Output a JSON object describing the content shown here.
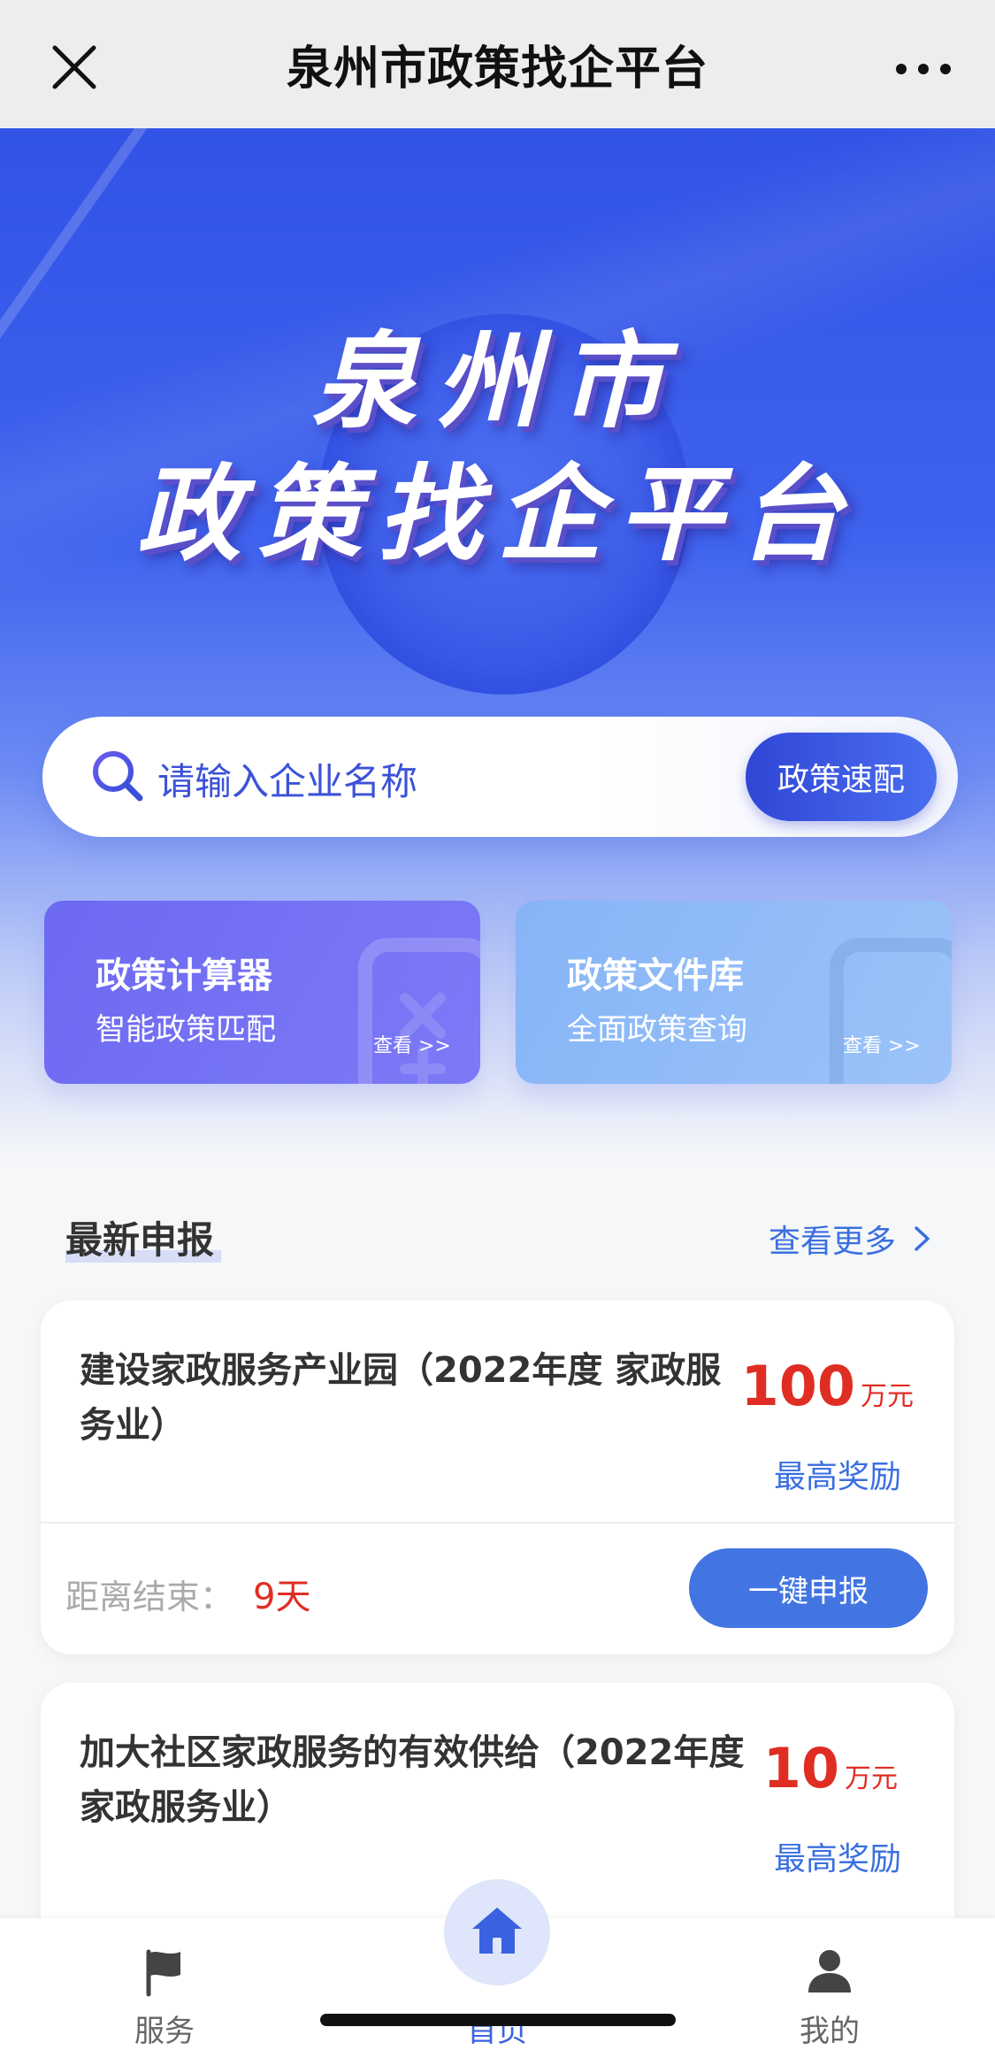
{
  "topbar": {
    "title": "泉州市政策找企平台"
  },
  "hero": {
    "logo_line1": "泉州市",
    "logo_line2": "政策找企平台"
  },
  "search": {
    "placeholder": "请输入企业名称",
    "button_label": "政策速配"
  },
  "cards": [
    {
      "title": "政策计算器",
      "subtitle": "智能政策匹配",
      "view_label": "查看 >>"
    },
    {
      "title": "政策文件库",
      "subtitle": "全面政策查询",
      "view_label": "查看 >>"
    }
  ],
  "section": {
    "title": "最新申报",
    "more_label": "查看更多"
  },
  "items": [
    {
      "title": "建设家政服务产业园（2022年度 家政服务业）",
      "amount": "100",
      "unit": "万元",
      "award_label": "最高奖励",
      "deadline_label": "距离结束：",
      "deadline_value": "9天",
      "apply_label": "一键申报"
    },
    {
      "title": "加大社区家政服务的有效供给（2022年度 家政服务业）",
      "amount": "10",
      "unit": "万元",
      "award_label": "最高奖励"
    }
  ],
  "tabbar": {
    "service": "服务",
    "home": "首页",
    "mine": "我的"
  },
  "colors": {
    "primary": "#3a62e0",
    "accent_red": "#e02d23",
    "card_purple": "#6d69f2",
    "card_blue": "#86b4f7"
  },
  "icons": {
    "close": "close-icon",
    "more": "more-dots-icon",
    "search": "search-icon",
    "chevron": "chevron-right-icon",
    "service": "flag-icon",
    "home": "home-icon",
    "mine": "user-icon"
  }
}
